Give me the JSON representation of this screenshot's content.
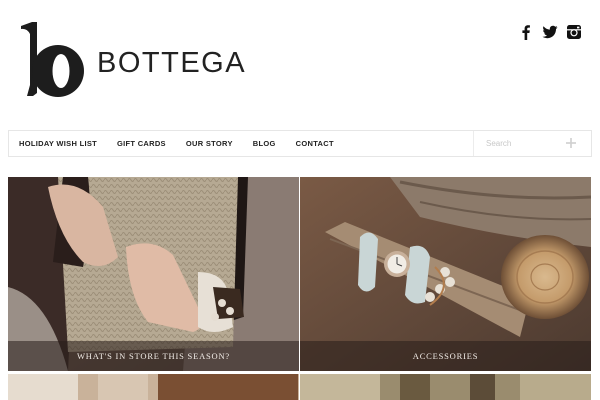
{
  "brand": {
    "name": "BOTTEGA",
    "logo_letter": "b"
  },
  "social": [
    {
      "icon": "facebook-icon"
    },
    {
      "icon": "twitter-icon"
    },
    {
      "icon": "instagram-icon"
    }
  ],
  "nav": {
    "items": [
      {
        "label": "HOLIDAY WISH LIST"
      },
      {
        "label": "GIFT CARDS"
      },
      {
        "label": "OUR STORY"
      },
      {
        "label": "BLOG"
      },
      {
        "label": "CONTACT"
      }
    ],
    "search_placeholder": "Search"
  },
  "tiles": [
    {
      "caption": "WHAT'S IN STORE THIS SEASON?",
      "image": "woman-knit-scarf-bracelets"
    },
    {
      "caption": "ACCESSORIES",
      "image": "wrap-watch-on-log"
    }
  ],
  "colors": {
    "accent_text": "#222222",
    "caption_overlay": "rgba(40,30,26,0.55)",
    "nav_border": "#e6e6e6"
  }
}
